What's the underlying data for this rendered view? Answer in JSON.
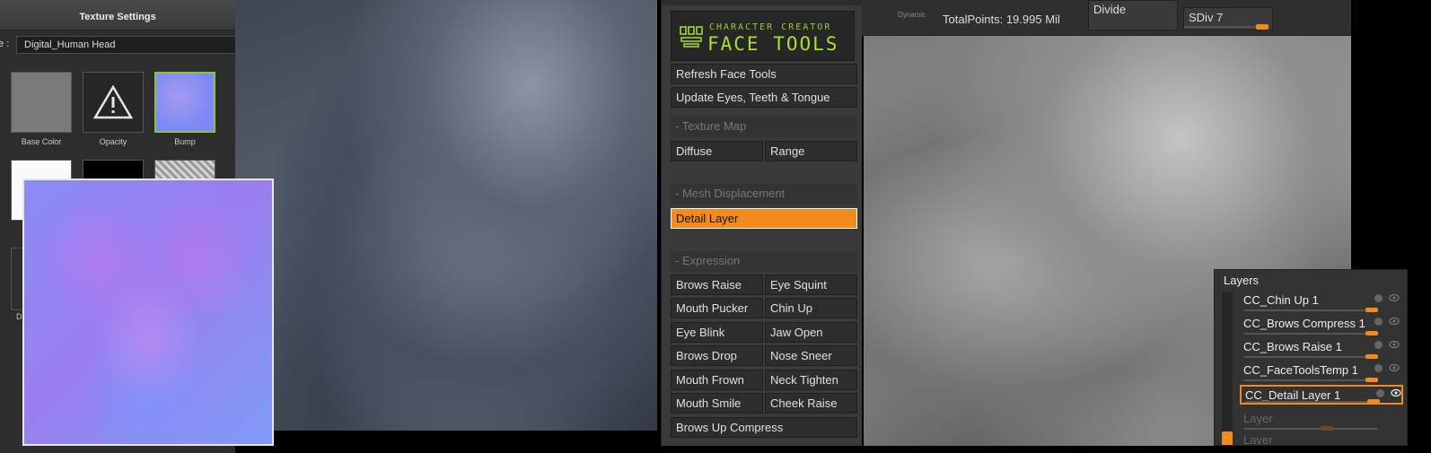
{
  "texture_settings": {
    "title": "Texture Settings",
    "name_prefix": "e :",
    "name_value": "Digital_Human Head",
    "slots": {
      "base_color": "Base Color",
      "opacity": "Opacity",
      "bump": "Bump"
    },
    "side_label_fragment": "D"
  },
  "face_tools": {
    "logo_top": "CHARACTER CREATOR",
    "logo_main": "FACE TOOLS",
    "buttons": {
      "refresh": "Refresh Face Tools",
      "update": "Update Eyes, Teeth & Tongue",
      "diffuse": "Diffuse",
      "range": "Range",
      "detail_layer": "Detail Layer",
      "brows_raise": "Brows Raise",
      "eye_squint": "Eye Squint",
      "mouth_pucker": "Mouth Pucker",
      "chin_up": "Chin Up",
      "eye_blink": "Eye Blink",
      "jaw_open": "Jaw Open",
      "brows_drop": "Brows Drop",
      "nose_sneer": "Nose Sneer",
      "mouth_frown": "Mouth Frown",
      "neck_tighten": "Neck Tighten",
      "mouth_smile": "Mouth Smile",
      "cheek_raise": "Cheek Raise",
      "brows_up_compress": "Brows Up Compress"
    },
    "sections": {
      "texture_map": "- Texture Map",
      "mesh_displacement": "- Mesh Displacement",
      "expression": "- Expression"
    }
  },
  "viewport": {
    "dynamic_label": "Dynamic",
    "total_points": "TotalPoints: 19.995 Mil",
    "divide_label": "Divide",
    "sdiv_label": "SDiv 7"
  },
  "layers": {
    "title": "Layers",
    "items": [
      {
        "name": "CC_Chin Up 1"
      },
      {
        "name": "CC_Brows Compress 1"
      },
      {
        "name": "CC_Brows Raise 1"
      },
      {
        "name": "CC_FaceToolsTemp 1"
      },
      {
        "name": "CC_Detail Layer 1"
      },
      {
        "name": "Layer"
      },
      {
        "name": "Layer"
      }
    ]
  },
  "colors": {
    "accent_orange": "#f28a1e",
    "logo_green": "#a8e02e",
    "selected_slot_border": "#8bc53f"
  }
}
